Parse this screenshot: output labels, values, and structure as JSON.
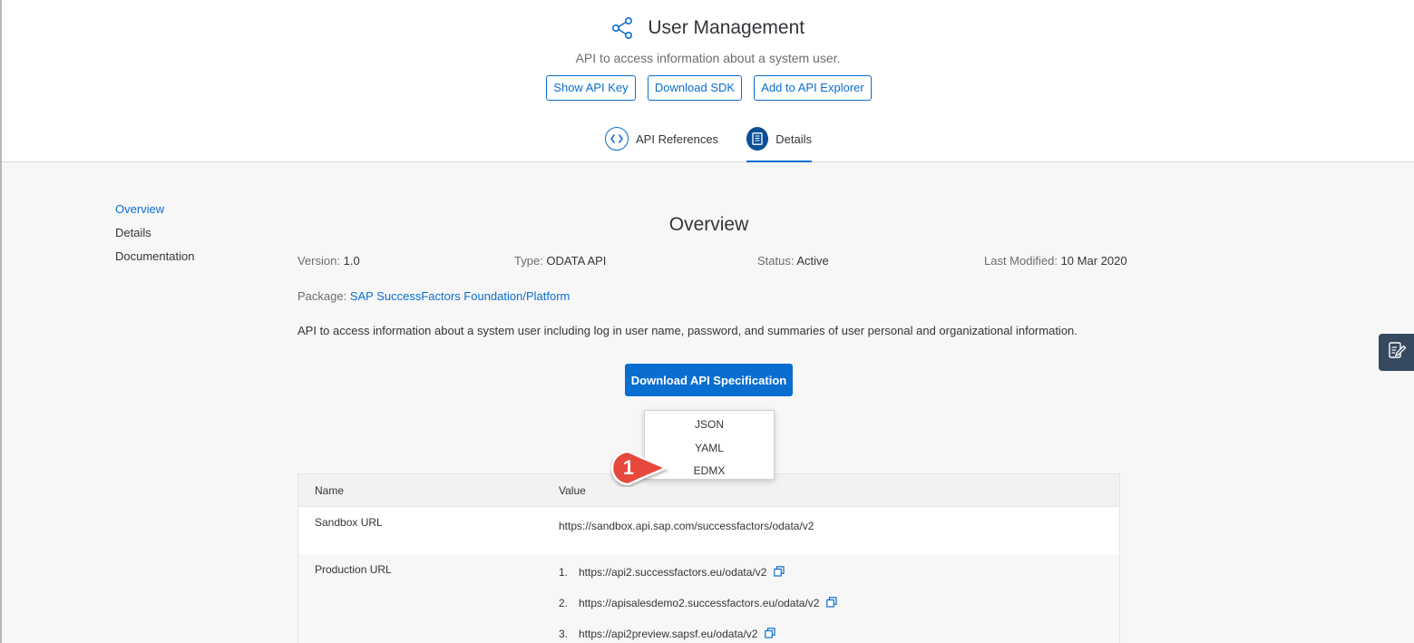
{
  "header": {
    "icon": "share-icon",
    "title": "User Management",
    "subtitle": "API to access information about a system user.",
    "buttons": {
      "show_api_key": "Show API Key",
      "download_sdk": "Download SDK",
      "add_to_explorer": "Add to API Explorer"
    },
    "tabs": [
      {
        "label": "API References",
        "icon": "code-icon",
        "active": false
      },
      {
        "label": "Details",
        "icon": "document-icon",
        "active": true
      }
    ]
  },
  "sidenav": {
    "items": [
      {
        "label": "Overview",
        "active": true
      },
      {
        "label": "Details",
        "active": false
      },
      {
        "label": "Documentation",
        "active": false
      }
    ]
  },
  "overview": {
    "title": "Overview",
    "version_label": "Version:",
    "version": "1.0",
    "type_label": "Type:",
    "type": "ODATA API",
    "status_label": "Status:",
    "status": "Active",
    "modified_label": "Last Modified:",
    "modified": "10 Mar 2020",
    "package_label": "Package:",
    "package": "SAP SuccessFactors Foundation/Platform",
    "description": "API to access information about a system user including log in user name, password, and summaries of user personal and organizational information.",
    "download_button": "Download API Specification"
  },
  "download_menu": {
    "options": [
      "JSON",
      "YAML",
      "EDMX"
    ]
  },
  "callout": {
    "number": "1",
    "color": "#e8473a"
  },
  "table": {
    "headers": {
      "name": "Name",
      "value": "Value"
    },
    "sandbox": {
      "name": "Sandbox URL",
      "value": "https://sandbox.api.sap.com/successfactors/odata/v2"
    },
    "production": {
      "name": "Production URL",
      "urls": [
        {
          "num": "1.",
          "url": "https://api2.successfactors.eu/odata/v2"
        },
        {
          "num": "2.",
          "url": "https://apisalesdemo2.successfactors.eu/odata/v2"
        },
        {
          "num": "3.",
          "url": "https://api2preview.sapsf.eu/odata/v2"
        }
      ]
    }
  },
  "colors": {
    "accent": "#0a6ed1",
    "feedback_bg": "#354a5f"
  }
}
